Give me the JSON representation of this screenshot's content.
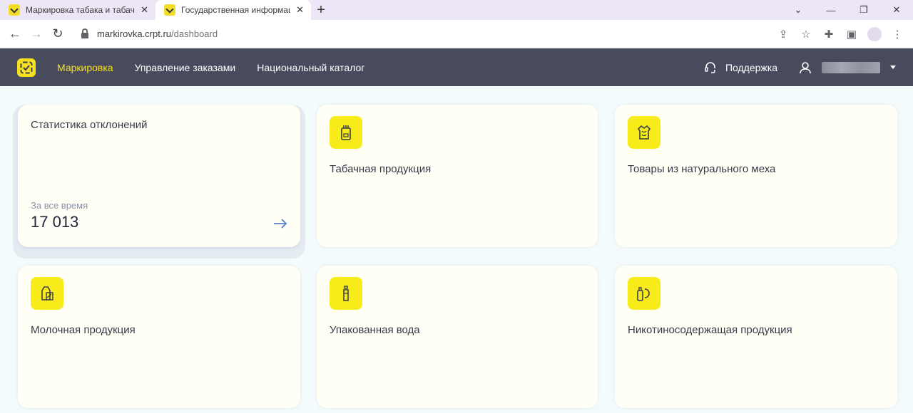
{
  "browser": {
    "tabs": [
      {
        "title": "Маркировка табака и табачной",
        "active": false
      },
      {
        "title": "Государственная информацио",
        "active": true
      }
    ],
    "new_tab": "+",
    "url_host": "markirovka.crpt.ru",
    "url_path": "/dashboard"
  },
  "header": {
    "nav": [
      "Маркировка",
      "Управление заказами",
      "Национальный каталог"
    ],
    "active_nav": "Маркировка",
    "support_label": "Поддержка",
    "accent_color": "#f7e11e",
    "bar_color": "#484a5d"
  },
  "stats": {
    "title": "Статистика отклонений",
    "period_label": "За все время",
    "value": "17 013"
  },
  "categories": [
    {
      "label": "Табачная продукция",
      "icon": "cigarette-pack-icon"
    },
    {
      "label": "Товары из натурального меха",
      "icon": "fur-coat-icon"
    },
    {
      "label": "Молочная продукция",
      "icon": "milk-carton-icon"
    },
    {
      "label": "Упакованная вода",
      "icon": "water-bottle-icon"
    },
    {
      "label": "Никотиносодержащая продукция",
      "icon": "vape-icon"
    }
  ]
}
